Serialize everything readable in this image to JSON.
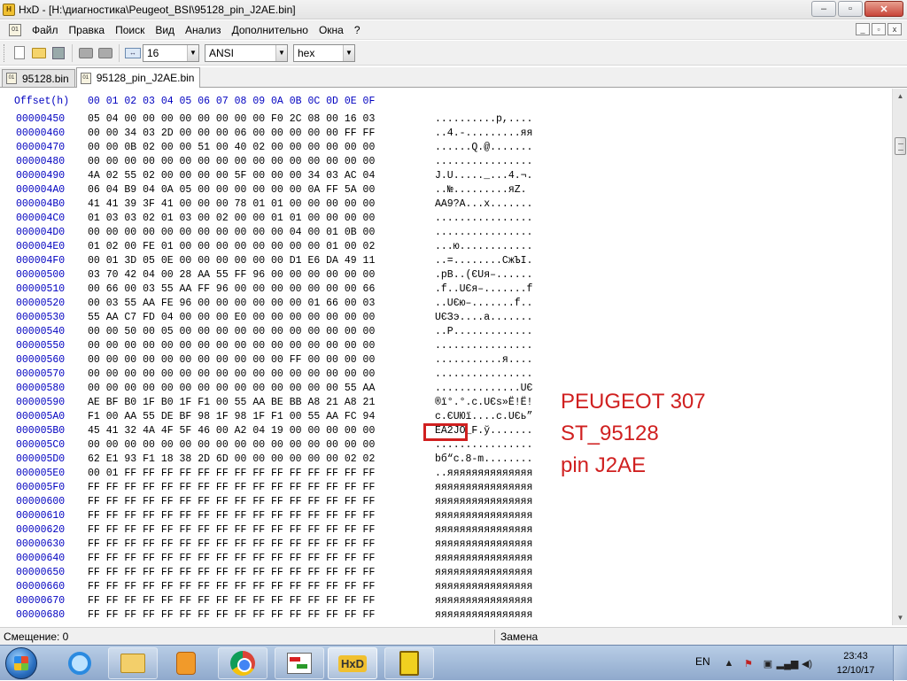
{
  "window": {
    "title": "HxD - [H:\\диагностика\\Peugeot_BSI\\95128_pin_J2AE.bin]",
    "minimize": "‒",
    "maximize": "▫",
    "close": "✕"
  },
  "menu": {
    "items": [
      "Файл",
      "Правка",
      "Поиск",
      "Вид",
      "Анализ",
      "Дополнительно",
      "Окна",
      "?"
    ],
    "mdi_minimize": "_",
    "mdi_restore": "▫",
    "mdi_close": "x"
  },
  "toolbar": {
    "bytes_per_row": "16",
    "charset": "ANSI",
    "offset_base": "hex",
    "dropdown_arrow": "▼",
    "cols_icon": "↔"
  },
  "tabs": [
    {
      "label": "95128.bin",
      "active": false
    },
    {
      "label": "95128_pin_J2AE.bin",
      "active": true
    }
  ],
  "hex": {
    "header_offset": "Offset(h)",
    "header_cols": "00 01 02 03 04 05 06 07 08 09 0A 0B 0C 0D 0E 0F",
    "rows": [
      {
        "offset": "00000450",
        "bytes": "05 04 00 00 00 00 00 00 00 00 F0 2C 08 00 16 03",
        "ascii": "..........р,...."
      },
      {
        "offset": "00000460",
        "bytes": "00 00 34 03 2D 00 00 00 06 00 00 00 00 00 FF FF",
        "ascii": "..4.-.........яя"
      },
      {
        "offset": "00000470",
        "bytes": "00 00 0B 02 00 00 51 00 40 02 00 00 00 00 00 00",
        "ascii": "......Q.@......."
      },
      {
        "offset": "00000480",
        "bytes": "00 00 00 00 00 00 00 00 00 00 00 00 00 00 00 00",
        "ascii": "................"
      },
      {
        "offset": "00000490",
        "bytes": "4A 02 55 02 00 00 00 00 5F 00 00 00 34 03 AC 04",
        "ascii": "J.U....._...4.¬."
      },
      {
        "offset": "000004A0",
        "bytes": "06 04 B9 04 0A 05 00 00 00 00 00 00 0A FF 5A 00",
        "ascii": "..№.........яZ."
      },
      {
        "offset": "000004B0",
        "bytes": "41 41 39 3F 41 00 00 00 78 01 01 00 00 00 00 00",
        "ascii": "AA9?A...x......."
      },
      {
        "offset": "000004C0",
        "bytes": "01 03 03 02 01 03 00 02 00 00 01 01 00 00 00 00",
        "ascii": "................"
      },
      {
        "offset": "000004D0",
        "bytes": "00 00 00 00 00 00 00 00 00 00 00 04 00 01 0B 00",
        "ascii": "................"
      },
      {
        "offset": "000004E0",
        "bytes": "01 02 00 FE 01 00 00 00 00 00 00 00 00 01 00 02",
        "ascii": "...ю............"
      },
      {
        "offset": "000004F0",
        "bytes": "00 01 3D 05 0E 00 00 00 00 00 00 D1 E6 DA 49 11",
        "ascii": "..=........СжЪI."
      },
      {
        "offset": "00000500",
        "bytes": "03 70 42 04 00 28 AA 55 FF 96 00 00 00 00 00 00",
        "ascii": ".pB..(ЄUя–......"
      },
      {
        "offset": "00000510",
        "bytes": "00 66 00 03 55 AA FF 96 00 00 00 00 00 00 00 66",
        "ascii": ".f..UЄя–.......f"
      },
      {
        "offset": "00000520",
        "bytes": "00 03 55 AA FE 96 00 00 00 00 00 00 01 66 00 03",
        "ascii": "..UЄю–.......f.."
      },
      {
        "offset": "00000530",
        "bytes": "55 AA C7 FD 04 00 00 00 E0 00 00 00 00 00 00 00",
        "ascii": "UЄЗэ....а......."
      },
      {
        "offset": "00000540",
        "bytes": "00 00 50 00 05 00 00 00 00 00 00 00 00 00 00 00",
        "ascii": "..P............."
      },
      {
        "offset": "00000550",
        "bytes": "00 00 00 00 00 00 00 00 00 00 00 00 00 00 00 00",
        "ascii": "................"
      },
      {
        "offset": "00000560",
        "bytes": "00 00 00 00 00 00 00 00 00 00 00 FF 00 00 00 00",
        "ascii": "...........я...."
      },
      {
        "offset": "00000570",
        "bytes": "00 00 00 00 00 00 00 00 00 00 00 00 00 00 00 00",
        "ascii": "................"
      },
      {
        "offset": "00000580",
        "bytes": "00 00 00 00 00 00 00 00 00 00 00 00 00 00 55 AA",
        "ascii": "..............UЄ"
      },
      {
        "offset": "00000590",
        "bytes": "AE BF B0 1F B0 1F F1 00 55 AA BE BB A8 21 A8 21",
        "ascii": "®ї°.°.с.UЄѕ»Ё!Ё!"
      },
      {
        "offset": "000005A0",
        "bytes": "F1 00 AA 55 DE BF 98 1F 98 1F F1 00 55 AA FC 94",
        "ascii": "с.ЄUЮї....с.UЄь”"
      },
      {
        "offset": "000005B0",
        "bytes": "45 41 32 4A 4F 5F 46 00 A2 04 19 00 00 00 00 00",
        "ascii": "EA2JO_F.ў......."
      },
      {
        "offset": "000005C0",
        "bytes": "00 00 00 00 00 00 00 00 00 00 00 00 00 00 00 00",
        "ascii": "................"
      },
      {
        "offset": "000005D0",
        "bytes": "62 E1 93 F1 18 38 2D 6D 00 00 00 00 00 00 02 02",
        "ascii": "bб“с.8-m........"
      },
      {
        "offset": "000005E0",
        "bytes": "00 01 FF FF FF FF FF FF FF FF FF FF FF FF FF FF",
        "ascii": "..яяяяяяяяяяяяяя"
      },
      {
        "offset": "000005F0",
        "bytes": "FF FF FF FF FF FF FF FF FF FF FF FF FF FF FF FF",
        "ascii": "яяяяяяяяяяяяяяяя"
      },
      {
        "offset": "00000600",
        "bytes": "FF FF FF FF FF FF FF FF FF FF FF FF FF FF FF FF",
        "ascii": "яяяяяяяяяяяяяяяя"
      },
      {
        "offset": "00000610",
        "bytes": "FF FF FF FF FF FF FF FF FF FF FF FF FF FF FF FF",
        "ascii": "яяяяяяяяяяяяяяяя"
      },
      {
        "offset": "00000620",
        "bytes": "FF FF FF FF FF FF FF FF FF FF FF FF FF FF FF FF",
        "ascii": "яяяяяяяяяяяяяяяя"
      },
      {
        "offset": "00000630",
        "bytes": "FF FF FF FF FF FF FF FF FF FF FF FF FF FF FF FF",
        "ascii": "яяяяяяяяяяяяяяяя"
      },
      {
        "offset": "00000640",
        "bytes": "FF FF FF FF FF FF FF FF FF FF FF FF FF FF FF FF",
        "ascii": "яяяяяяяяяяяяяяяя"
      },
      {
        "offset": "00000650",
        "bytes": "FF FF FF FF FF FF FF FF FF FF FF FF FF FF FF FF",
        "ascii": "яяяяяяяяяяяяяяяя"
      },
      {
        "offset": "00000660",
        "bytes": "FF FF FF FF FF FF FF FF FF FF FF FF FF FF FF FF",
        "ascii": "яяяяяяяяяяяяяяяя"
      },
      {
        "offset": "00000670",
        "bytes": "FF FF FF FF FF FF FF FF FF FF FF FF FF FF FF FF",
        "ascii": "яяяяяяяяяяяяяяяя"
      },
      {
        "offset": "00000680",
        "bytes": "FF FF FF FF FF FF FF FF FF FF FF FF FF FF FF FF",
        "ascii": "яяяяяяяяяяяяяяяя"
      }
    ]
  },
  "annotation": {
    "lines": [
      "PEUGEOT 307",
      "ST_95128",
      "pin J2AE"
    ],
    "color": "#d02020"
  },
  "scrollbar": {
    "up_arrow": "▲",
    "down_arrow": "▼"
  },
  "status": {
    "left": "Смещение: 0",
    "right": "Замена"
  },
  "taskbar": {
    "hxd_label": "HxD",
    "language": "EN",
    "tray_arrow": "▲",
    "tray_flag": "⚑",
    "tray_device": "▣",
    "tray_signal": "▂▄▆",
    "tray_volume": "◀)",
    "time": "23:43",
    "date": "12/10/17"
  }
}
